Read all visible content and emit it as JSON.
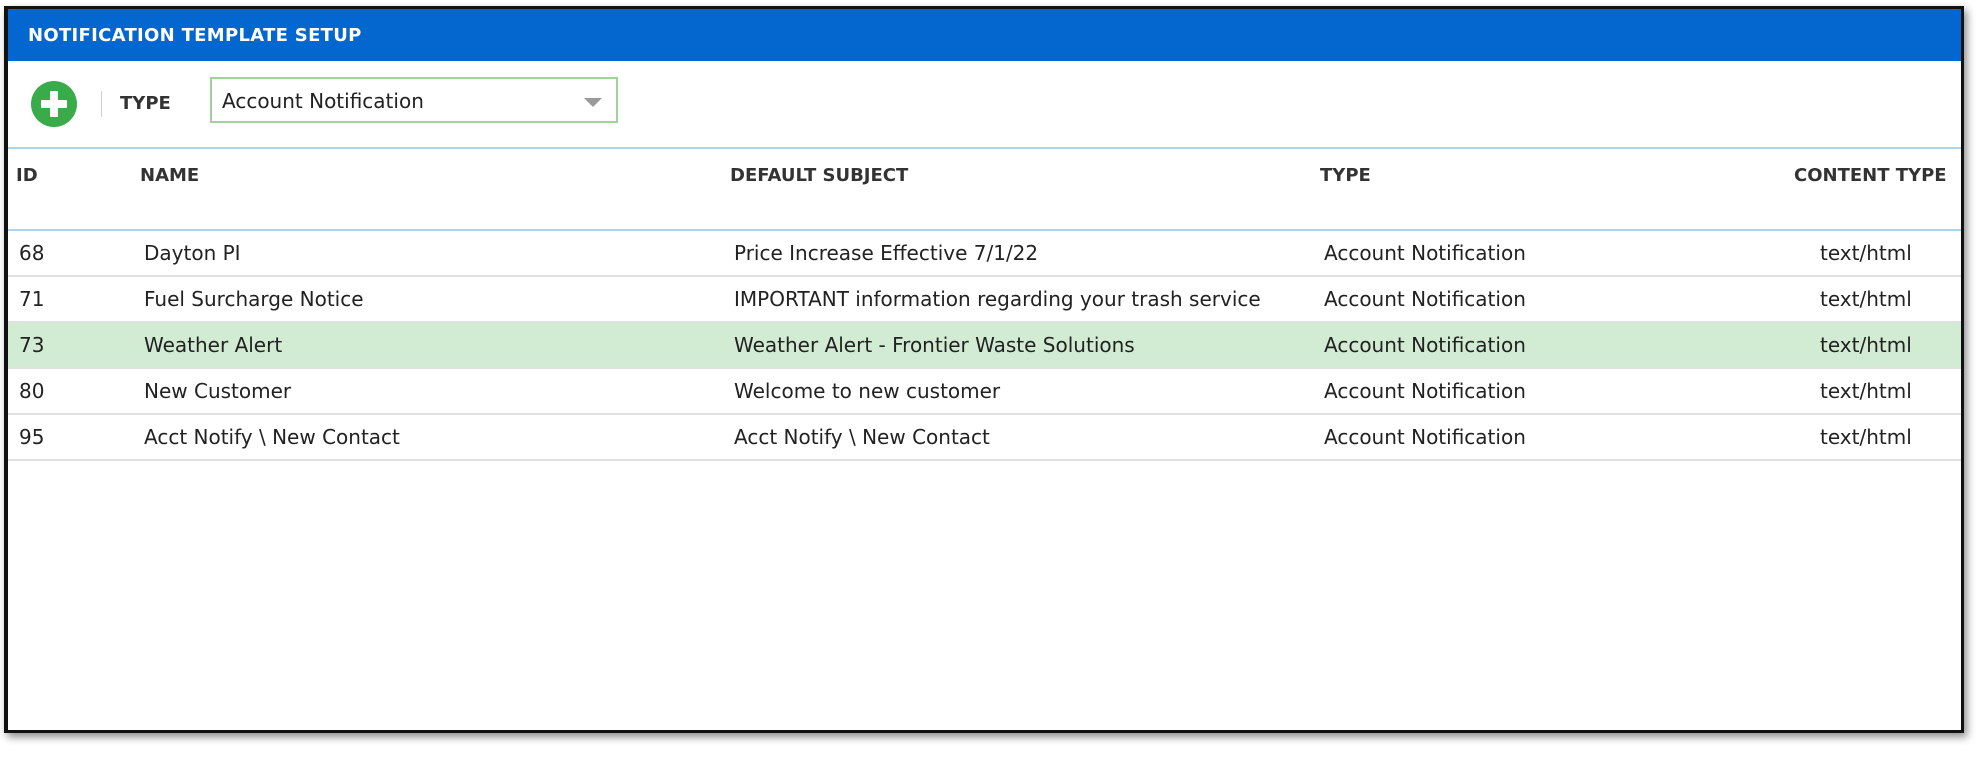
{
  "window": {
    "title": "NOTIFICATION TEMPLATE SETUP"
  },
  "toolbar": {
    "add_icon": "plus-circle-icon",
    "type_label": "TYPE",
    "type_value": "Account Notification",
    "type_caret_icon": "chevron-down-icon"
  },
  "grid": {
    "columns": {
      "id": "ID",
      "name": "NAME",
      "subject": "DEFAULT SUBJECT",
      "type": "TYPE",
      "content_type": "CONTENT TYPE"
    },
    "rows": [
      {
        "id": "68",
        "name": "Dayton PI",
        "subject": "Price Increase Effective 7/1/22",
        "type": "Account Notification",
        "content_type": "text/html",
        "selected": false
      },
      {
        "id": "71",
        "name": "Fuel Surcharge Notice",
        "subject": "IMPORTANT information regarding your trash service",
        "type": "Account Notification",
        "content_type": "text/html",
        "selected": false
      },
      {
        "id": "73",
        "name": "Weather Alert",
        "subject": "Weather Alert - Frontier Waste Solutions",
        "type": "Account Notification",
        "content_type": "text/html",
        "selected": true
      },
      {
        "id": "80",
        "name": "New Customer",
        "subject": "Welcome to new customer",
        "type": "Account Notification",
        "content_type": "text/html",
        "selected": false
      },
      {
        "id": "95",
        "name": "Acct Notify \\ New Contact",
        "subject": "Acct Notify \\ New Contact",
        "type": "Account Notification",
        "content_type": "text/html",
        "selected": false
      }
    ]
  },
  "colors": {
    "titlebar": "#0466cf",
    "add_button": "#3aab49",
    "selected_row": "#d2ebd3",
    "select_border": "#9fd39a"
  }
}
